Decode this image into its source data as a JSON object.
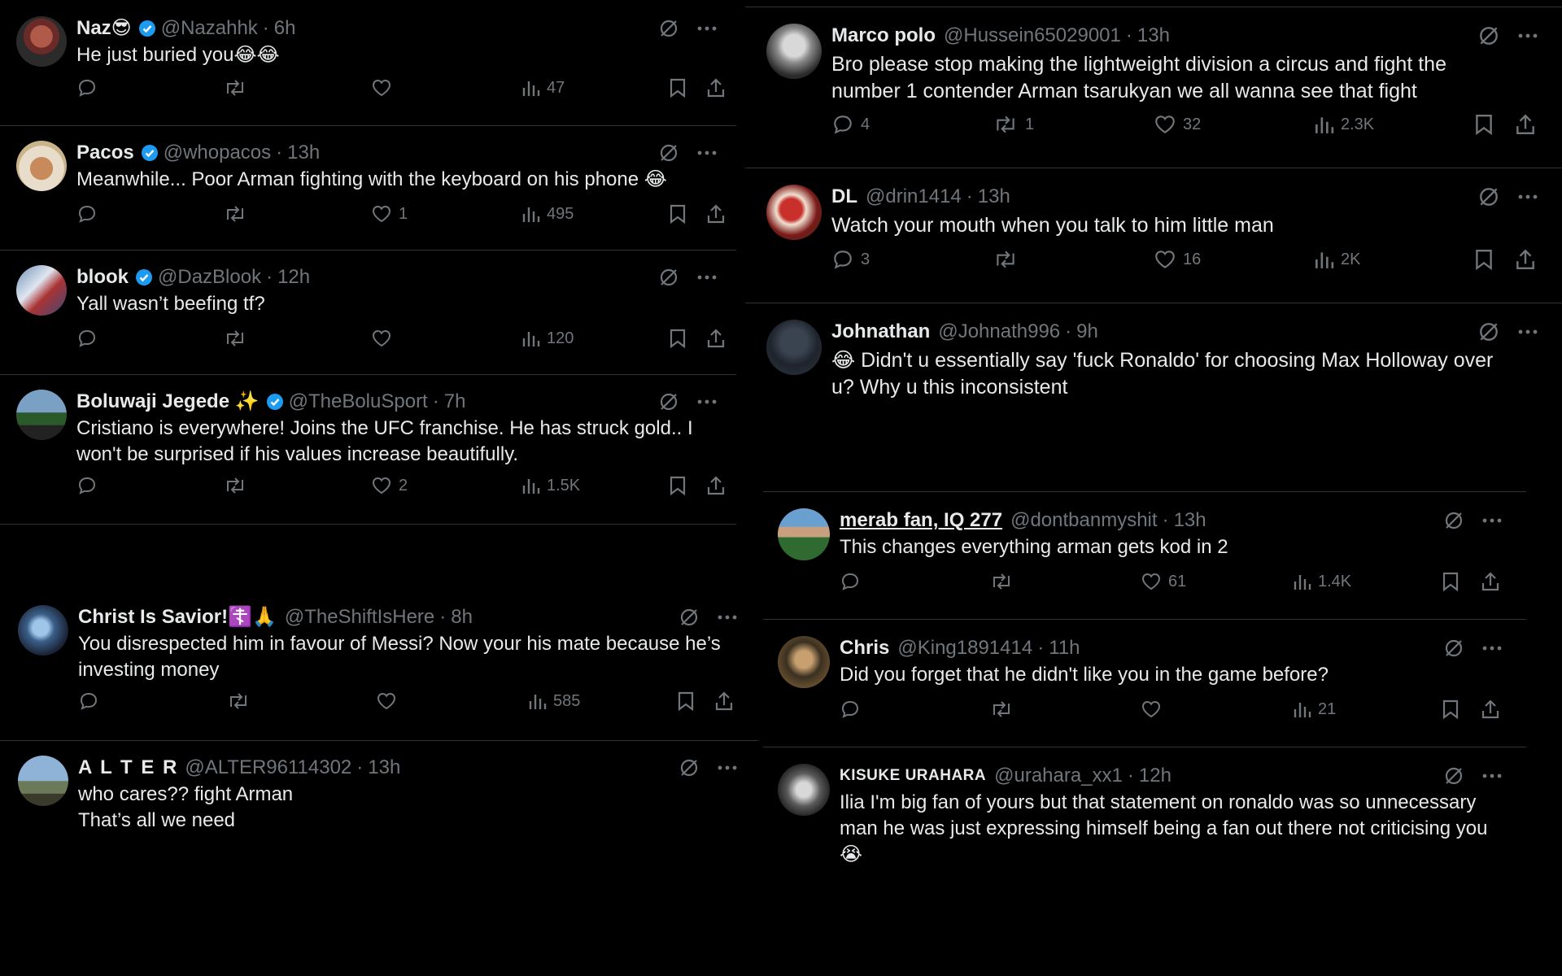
{
  "left": [
    {
      "name": "Naz😎",
      "verified": true,
      "handle": "@Nazahhk",
      "time": "6h",
      "text": "He just buried you😂😂",
      "reply": "",
      "retweet": "",
      "like": "",
      "views": "47"
    },
    {
      "name": "Pacos",
      "verified": true,
      "handle": "@whopacos",
      "time": "13h",
      "text": "Meanwhile... Poor Arman fighting with the keyboard on his phone 😂",
      "reply": "",
      "retweet": "",
      "like": "1",
      "views": "495"
    },
    {
      "name": "blook",
      "verified": true,
      "handle": "@DazBlook",
      "time": "12h",
      "text": "Yall wasn’t beefing tf?",
      "reply": "",
      "retweet": "",
      "like": "",
      "views": "120"
    },
    {
      "name": "Boluwaji Jegede ✨",
      "verified": true,
      "handle": "@TheBoluSport",
      "time": "7h",
      "text": "Cristiano is everywhere! Joins the UFC franchise. He has struck gold.. I\nwon't be surprised if his values increase beautifully.",
      "reply": "",
      "retweet": "",
      "like": "2",
      "views": "1.5K"
    }
  ],
  "left2": [
    {
      "name": "Christ Is Savior!☦️🙏",
      "verified": false,
      "handle": "@TheShiftIsHere",
      "time": "8h",
      "text": "You disrespected him in favour of Messi? Now your his mate because he’s\ninvesting money",
      "reply": "",
      "retweet": "",
      "like": "",
      "views": "585"
    },
    {
      "name": "A L T E R",
      "verified": false,
      "handle": "@ALTER96114302",
      "time": "13h",
      "text": "who cares?? fight Arman\nThat’s all we need"
    }
  ],
  "right": [
    {
      "name": "Marco polo",
      "verified": false,
      "handle": "@Hussein65029001",
      "time": "13h",
      "text": "Bro please stop making the lightweight division a circus and fight the\nnumber 1 contender Arman tsarukyan we all wanna see that fight",
      "reply": "4",
      "retweet": "1",
      "like": "32",
      "views": "2.3K"
    },
    {
      "name": "DL",
      "verified": false,
      "handle": "@drin1414",
      "time": "13h",
      "text": "Watch your mouth when you talk to him little man",
      "reply": "3",
      "retweet": "",
      "like": "16",
      "views": "2K"
    },
    {
      "name": "Johnathan",
      "verified": false,
      "handle": "@Johnath996",
      "time": "9h",
      "text": "😂 Didn't u essentially say 'fuck Ronaldo' for choosing Max Holloway over\nu? Why u this inconsistent"
    }
  ],
  "right2": [
    {
      "name": "merab fan, IQ 277",
      "verified": false,
      "handle": "@dontbanmyshit",
      "time": "13h",
      "text": "This changes everything arman gets kod in 2",
      "reply": "",
      "retweet": "",
      "like": "61",
      "views": "1.4K"
    },
    {
      "name": "Chris",
      "verified": false,
      "handle": "@King1891414",
      "time": "11h",
      "text": "Did you forget that he didn't like you in the game before?",
      "reply": "",
      "retweet": "",
      "like": "",
      "views": "21"
    },
    {
      "name": "KISUKE URAHARA",
      "verified": false,
      "handle": "@urahara_xx1",
      "time": "12h",
      "text": "Ilia I'm big fan of yours but that statement on ronaldo was so unnecessary\nman he was just expressing himself being a fan out there not criticising you\n😭"
    }
  ],
  "icons": {
    "grok": "grok-icon",
    "more": "more-icon",
    "reply": "reply-icon",
    "retweet": "retweet-icon",
    "like": "like-icon",
    "views": "views-icon",
    "bookmark": "bookmark-icon",
    "share": "share-icon",
    "verified": "verified-badge-icon"
  },
  "colors": {
    "bg": "#000000",
    "text": "#e7e9ea",
    "muted": "#71767b",
    "verified": "#1d9bf0",
    "border": "#2f3336"
  }
}
